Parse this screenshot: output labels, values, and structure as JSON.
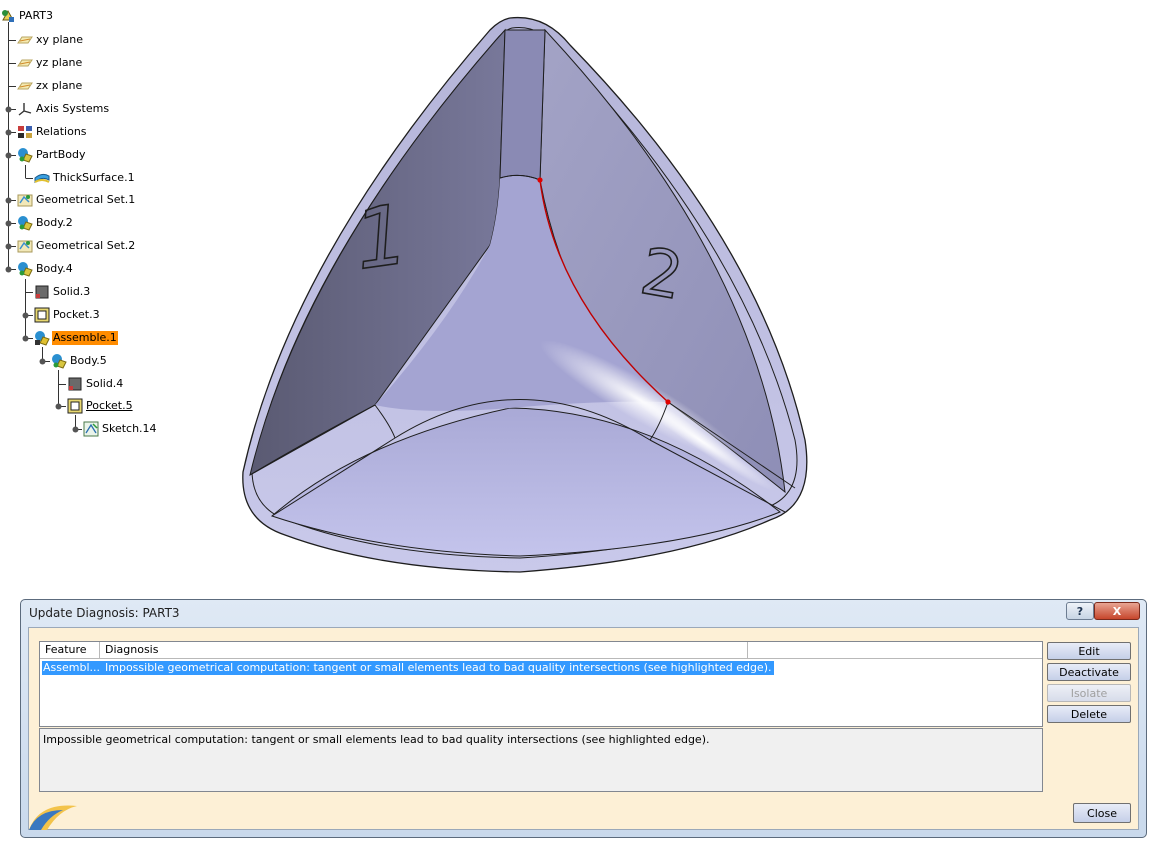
{
  "tree": {
    "items": [
      {
        "label": "PART3",
        "icon": "part-icon"
      },
      {
        "label": "xy plane",
        "icon": "plane-icon"
      },
      {
        "label": "yz plane",
        "icon": "plane-icon"
      },
      {
        "label": "zx plane",
        "icon": "plane-icon"
      },
      {
        "label": "Axis Systems",
        "icon": "axis-system-icon"
      },
      {
        "label": "Relations",
        "icon": "relations-icon"
      },
      {
        "label": "PartBody",
        "icon": "body-icon"
      },
      {
        "label": "ThickSurface.1",
        "icon": "thick-surface-icon"
      },
      {
        "label": "Geometrical Set.1",
        "icon": "geometrical-set-icon"
      },
      {
        "label": "Body.2",
        "icon": "body-icon"
      },
      {
        "label": "Geometrical Set.2",
        "icon": "geometrical-set-icon"
      },
      {
        "label": "Body.4",
        "icon": "body-icon"
      },
      {
        "label": "Solid.3",
        "icon": "solid-icon"
      },
      {
        "label": "Pocket.3",
        "icon": "pocket-icon"
      },
      {
        "label": "Assemble.1",
        "icon": "assemble-icon",
        "highlighted": true
      },
      {
        "label": "Body.5",
        "icon": "body-icon"
      },
      {
        "label": "Solid.4",
        "icon": "solid-icon"
      },
      {
        "label": "Pocket.5",
        "icon": "pocket-icon",
        "underlined": true
      },
      {
        "label": "Sketch.14",
        "icon": "sketch-icon"
      }
    ]
  },
  "viewport": {
    "face_labels": [
      "1",
      "2"
    ],
    "colors": {
      "face_left": "#6b6b86",
      "face_right": "#9a9ac0",
      "face_bottom": "#bcbce3",
      "highlight_edge": "#c00000"
    }
  },
  "dialog": {
    "title": "Update Diagnosis: PART3",
    "help_label": "?",
    "close_x_label": "X",
    "columns": [
      "Feature",
      "Diagnosis"
    ],
    "rows": [
      {
        "feature": "Assembl...",
        "diagnosis": "Impossible geometrical computation: tangent or small elements lead to bad quality intersections (see highlighted edge)."
      }
    ],
    "detail": "Impossible geometrical computation: tangent or small elements lead to bad quality intersections (see highlighted edge).",
    "buttons": {
      "edit": "Edit",
      "deactivate": "Deactivate",
      "isolate": "Isolate",
      "delete": "Delete",
      "close": "Close"
    },
    "colors": {
      "selection": "#3399ff",
      "client_bg": "#fdf0d6"
    }
  }
}
